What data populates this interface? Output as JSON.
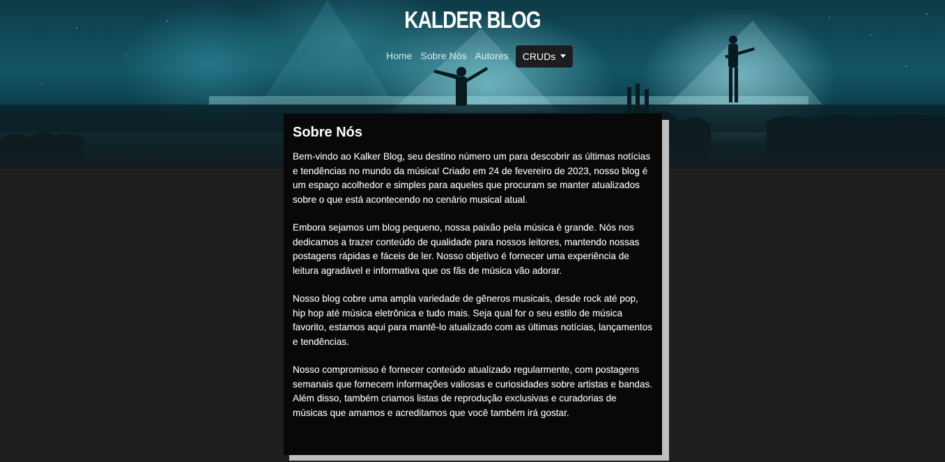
{
  "header": {
    "brand": "KALDER BLOG"
  },
  "nav": {
    "items": [
      "Home",
      "Sobre Nós",
      "Autores"
    ],
    "dropdown_label": "CRUDs"
  },
  "about": {
    "title": "Sobre Nós",
    "paragraphs": [
      "Bem-vindo ao Kalker Blog, seu destino número um para descobrir as últimas notícias e tendências no mundo da música! Criado em 24 de fevereiro de 2023, nosso blog é um espaço acolhedor e simples para aqueles que procuram se manter atualizados sobre o que está acontecendo no cenário musical atual.",
      "Embora sejamos um blog pequeno, nossa paixão pela música é grande. Nós nos dedicamos a trazer conteúdo de qualidade para nossos leitores, mantendo nossas postagens rápidas e fáceis de ler. Nosso objetivo é fornecer uma experiência de leitura agradável e informativa que os fãs de música vão adorar.",
      "Nosso blog cobre uma ampla variedade de gêneros musicais, desde rock até pop, hip hop até música eletrônica e tudo mais. Seja qual for o seu estilo de música favorito, estamos aqui para mantê-lo atualizado com as últimas notícias, lançamentos e tendências.",
      "Nosso compromisso é fornecer conteúdo atualizado regularmente, com postagens semanais que fornecem informações valiosas e curiosidades sobre artistas e bandas. Além disso, também criamos listas de reprodução exclusivas e curadorias de músicas que amamos e acreditamos que você também irá gostar."
    ]
  },
  "colors": {
    "page_background": "#1f1f1f",
    "card_background": "#080808",
    "card_shadow": "#bfbfbf",
    "hero_tint": "#125565"
  }
}
